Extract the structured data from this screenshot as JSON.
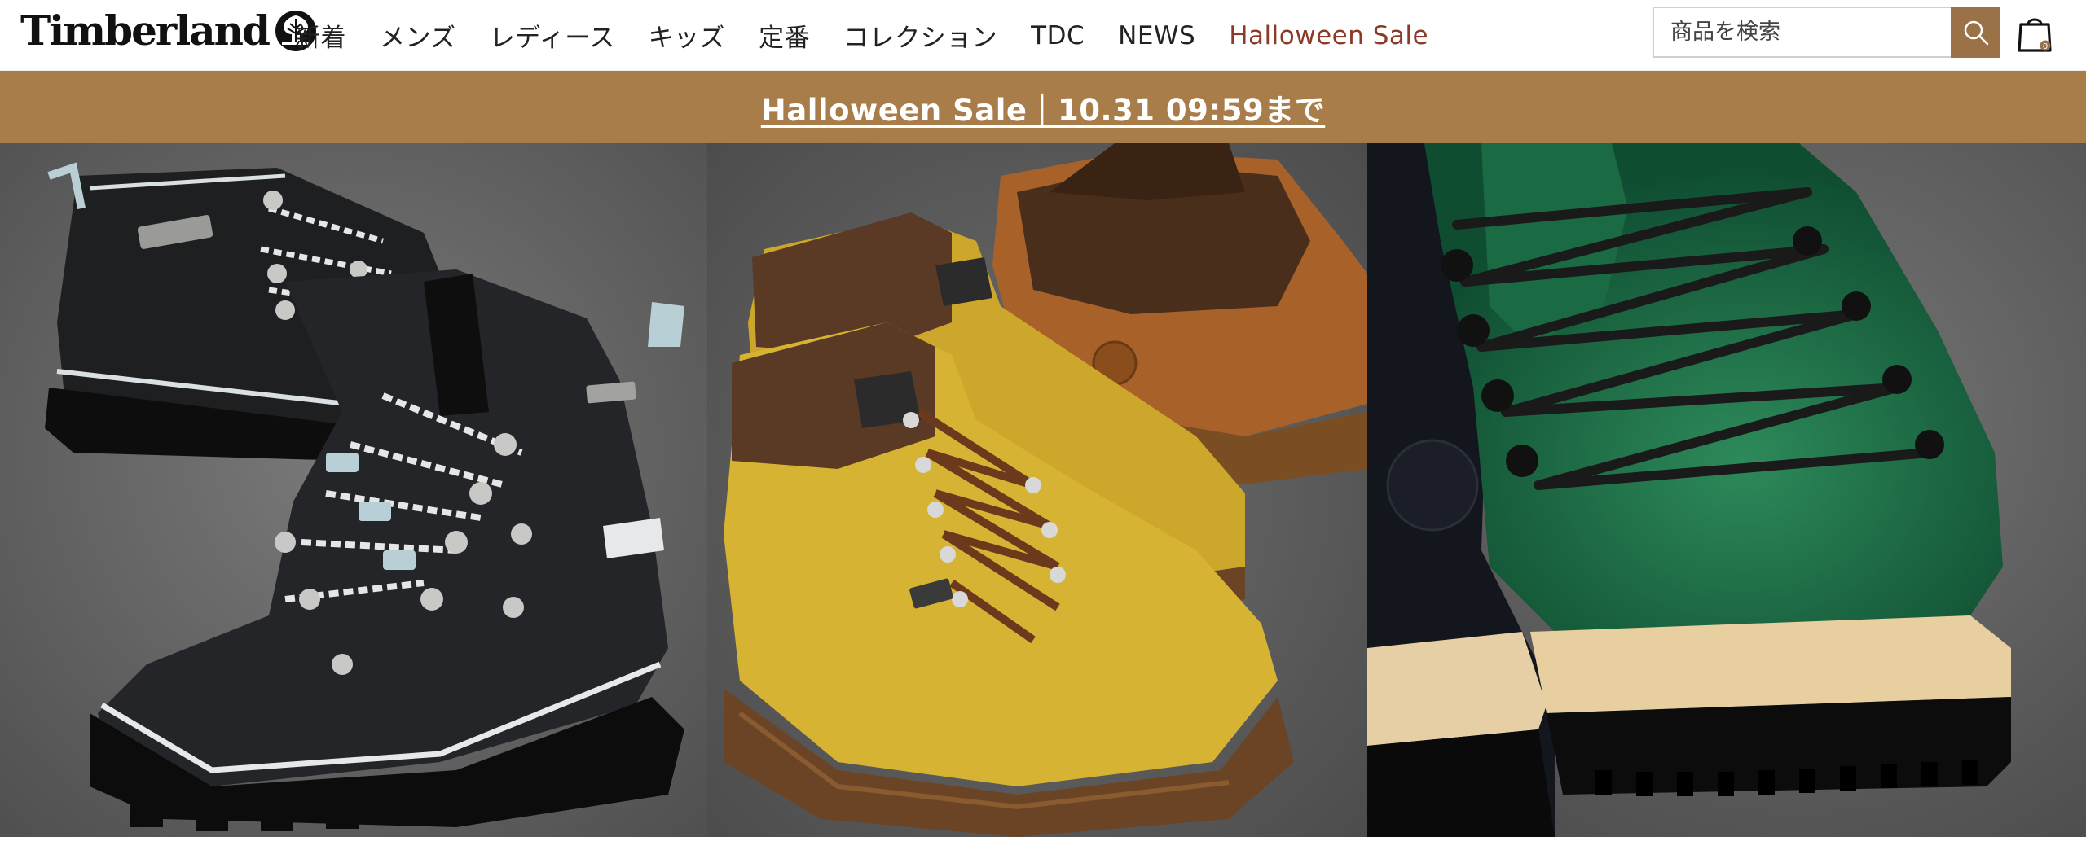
{
  "brand": {
    "name": "Timberland"
  },
  "nav": {
    "items": [
      {
        "label": "新着"
      },
      {
        "label": "メンズ"
      },
      {
        "label": "レディース"
      },
      {
        "label": "キッズ"
      },
      {
        "label": "定番"
      },
      {
        "label": "コレクション"
      },
      {
        "label": "TDC"
      },
      {
        "label": "NEWS"
      },
      {
        "label": "Halloween Sale"
      }
    ]
  },
  "search": {
    "placeholder": "商品を検索",
    "icon": "search-icon"
  },
  "cart": {
    "icon": "shopping-bag-icon",
    "count": "0"
  },
  "promo": {
    "text": "Halloween Sale｜10.31 09:59まで"
  },
  "colors": {
    "sale_text": "#8b3a27",
    "promo_bg": "#a87d49",
    "search_button": "#9b7147"
  },
  "hero": {
    "panels": [
      {
        "subject": "black-hiking-boots"
      },
      {
        "subject": "yellow-and-brown-field-boots"
      },
      {
        "subject": "green-leather-boot-closeup"
      }
    ]
  }
}
